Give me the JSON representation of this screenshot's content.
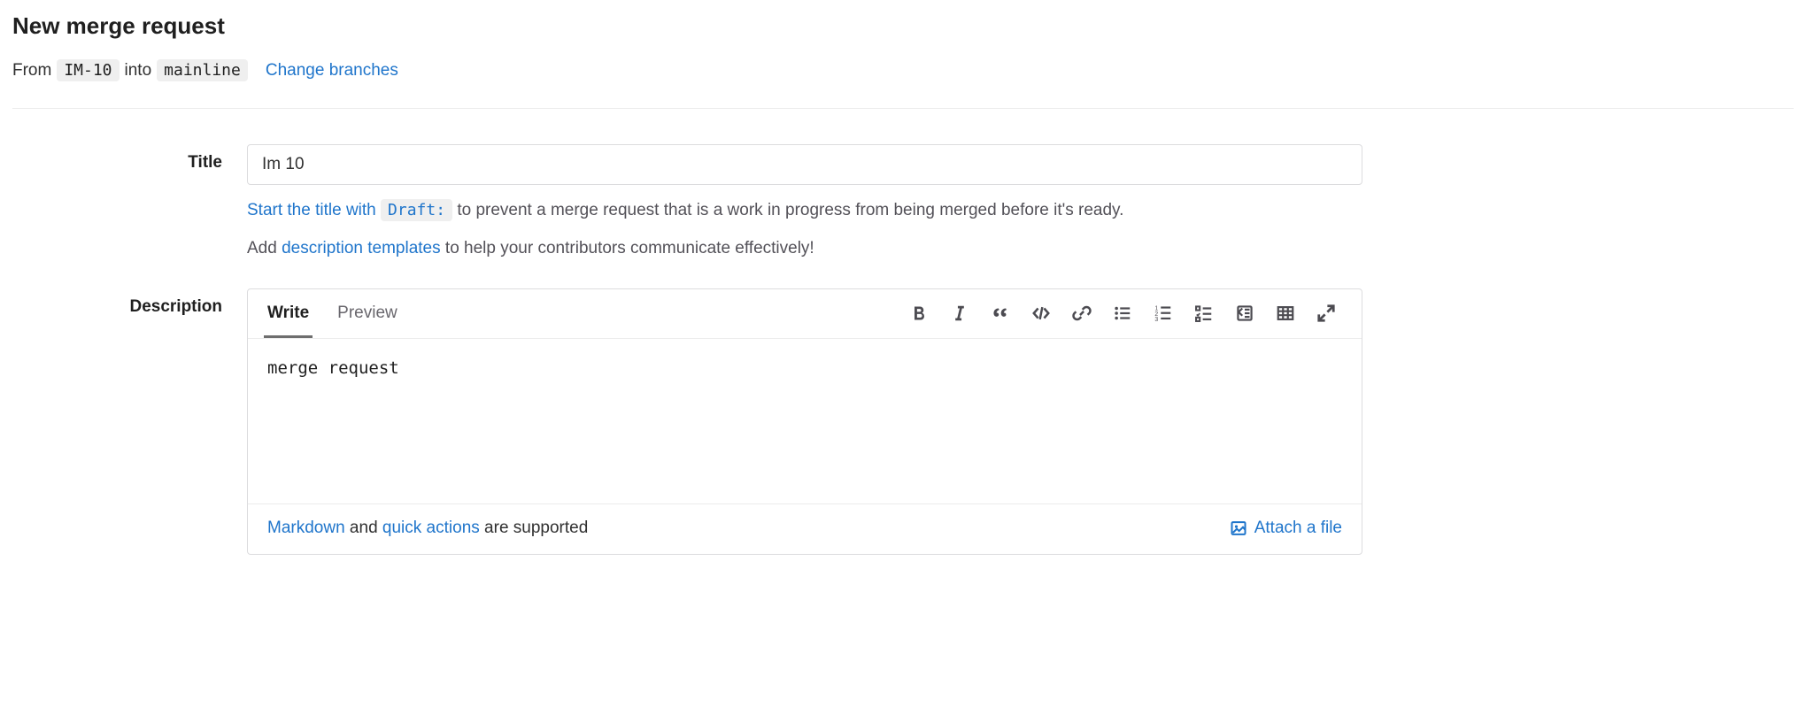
{
  "page": {
    "heading": "New merge request"
  },
  "branches": {
    "from_label": "From",
    "source": "IM-10",
    "into_label": "into",
    "target": "mainline",
    "change_link": "Change branches"
  },
  "title_section": {
    "label": "Title",
    "value": "Im 10",
    "hint_prefix": "Start the title with ",
    "hint_code": "Draft:",
    "hint_suffix": " to prevent a merge request that is a work in progress from being merged before it's ready.",
    "hint2_prefix": "Add ",
    "hint2_link": "description templates",
    "hint2_suffix": " to help your contributors communicate effectively!"
  },
  "description": {
    "label": "Description",
    "tabs": {
      "write": "Write",
      "preview": "Preview"
    },
    "value": "merge request",
    "footer": {
      "markdown_link": "Markdown",
      "mid": " and ",
      "quick_link": "quick actions",
      "suffix": " are supported",
      "attach": "Attach a file"
    }
  }
}
